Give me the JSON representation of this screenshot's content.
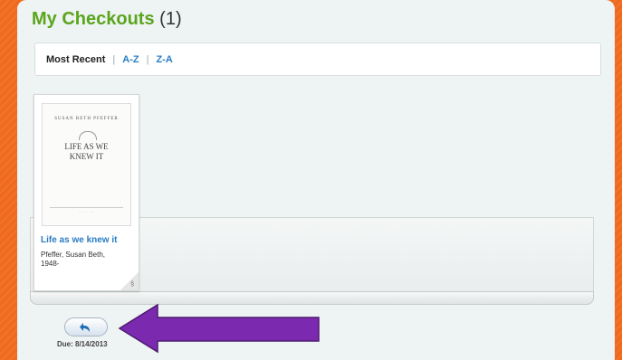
{
  "header": {
    "title": "My Checkouts",
    "count": "(1)"
  },
  "sort": {
    "active": "Most Recent",
    "separator": "|",
    "options": [
      "A-Z",
      "Z-A"
    ]
  },
  "checkouts": [
    {
      "cover": {
        "author": "SUSAN BETH PFEFFER",
        "title_line1": "LIFE AS WE",
        "title_line2": "KNEW IT",
        "footer": "· · · · · · · ·"
      },
      "title": "Life as we knew it",
      "author_line1": "Pfeffer, Susan Beth,",
      "author_line2": "1948-",
      "corner_glyph": "§",
      "due": "Due: 8/14/2013"
    }
  ],
  "icons": {
    "return": "return-arrow-icon",
    "annotation": "purple-arrow-icon"
  },
  "colors": {
    "background": "#ef6a1e",
    "title_green": "#5aa51d",
    "link_blue": "#2a7cc4",
    "arrow_purple": "#7b2ab0"
  }
}
